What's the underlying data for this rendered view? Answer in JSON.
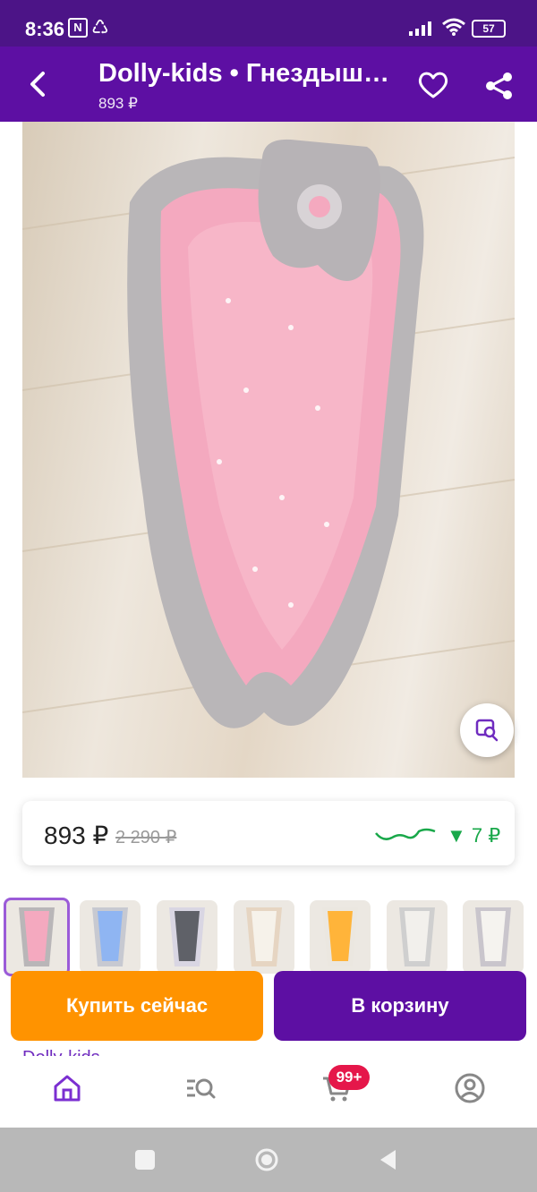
{
  "status_bar": {
    "time": "8:36",
    "battery": "57"
  },
  "app_bar": {
    "title": "Dolly-kids • Гнездыш…",
    "subtitle": "893 ₽"
  },
  "product": {
    "image_alt": "Гнездышко"
  },
  "price_card": {
    "price": "893 ₽",
    "old_price": "2 290 ₽",
    "drop": "▼ 7 ₽"
  },
  "thumbnails": [
    "pink",
    "blue",
    "gray-dark",
    "white-stars",
    "orange",
    "white-gray",
    "white-print"
  ],
  "actions": {
    "buy_now": "Купить сейчас",
    "add_to_cart": "В корзину"
  },
  "seller_peek": "Dolly-kids",
  "bottom_nav": {
    "cart_badge": "99+"
  },
  "colors": {
    "appbar": "#5d0fa3",
    "status": "#4c1487",
    "buy": "#ff9300",
    "accent": "#6f2bbf",
    "drop": "#19a84a",
    "badge": "#e5174a"
  }
}
